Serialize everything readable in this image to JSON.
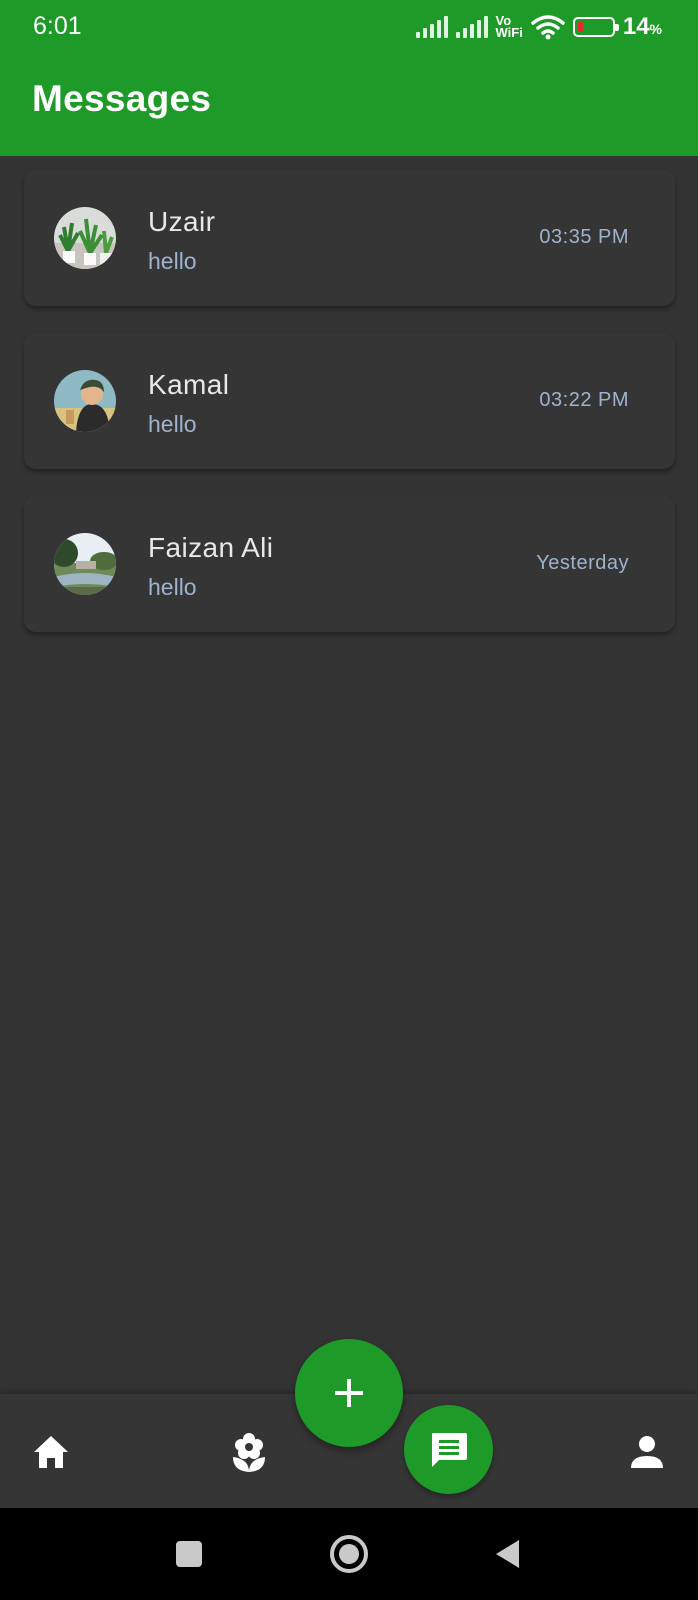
{
  "status_bar": {
    "time": "6:01",
    "vo_line1": "Vo",
    "vo_line2": "WiFi",
    "battery_percent": "14",
    "battery_unit": "%"
  },
  "app_bar": {
    "title": "Messages"
  },
  "conversations": [
    {
      "name": "Uzair",
      "preview": "hello",
      "time": "03:35 PM",
      "avatar_icon": "plants-photo-avatar"
    },
    {
      "name": "Kamal",
      "preview": "hello",
      "time": "03:22 PM",
      "avatar_icon": "cartoon-person-avatar"
    },
    {
      "name": "Faizan Ali",
      "preview": "hello",
      "time": "Yesterday",
      "avatar_icon": "landscape-photo-avatar"
    }
  ],
  "bottom_nav": {
    "items": [
      "home-icon",
      "flower-icon",
      "chat-icon",
      "person-icon"
    ],
    "fab_icon": "plus-icon"
  },
  "system_nav": [
    "square-icon",
    "circle-icon",
    "back-triangle-icon"
  ],
  "colors": {
    "primary": "#1e9a28",
    "background": "#333333",
    "card": "#353535",
    "secondary_text": "#9eb3cd"
  }
}
